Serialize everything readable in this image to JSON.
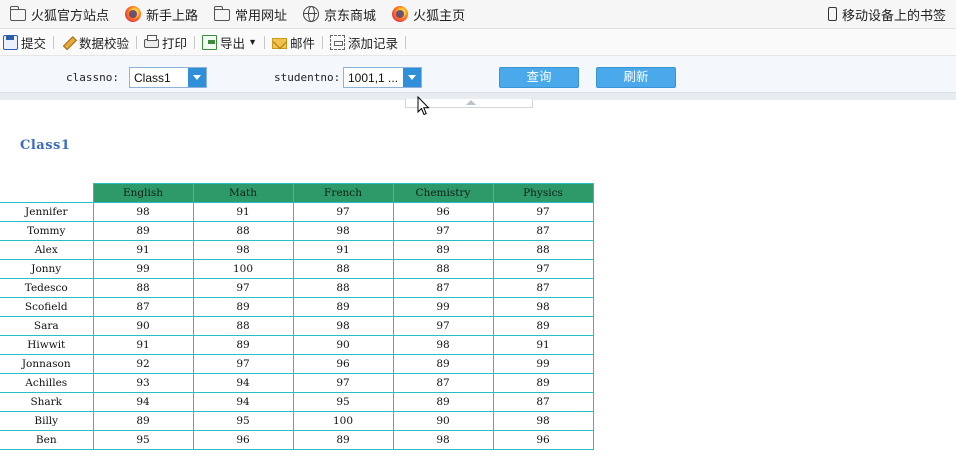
{
  "bookmarks": {
    "items": [
      {
        "label": "火狐官方站点",
        "icon": "folder-icon"
      },
      {
        "label": "新手上路",
        "icon": "firefox-icon"
      },
      {
        "label": "常用网址",
        "icon": "folder-icon"
      },
      {
        "label": "京东商城",
        "icon": "globe-icon"
      },
      {
        "label": "火狐主页",
        "icon": "firefox-icon"
      }
    ],
    "mobile_label": "移动设备上的书签"
  },
  "toolbar": {
    "submit": "提交",
    "validate": "数据校验",
    "print": "打印",
    "export": "导出",
    "mail": "邮件",
    "add_record": "添加记录"
  },
  "params": {
    "classno_label": "classno:",
    "classno_value": "Class1",
    "studentno_label": "studentno:",
    "studentno_value": "1001,1 ...",
    "query_label": "查询",
    "refresh_label": "刷新"
  },
  "report": {
    "title": "Class1",
    "columns": [
      "English",
      "Math",
      "French",
      "Chemistry",
      "Physics"
    ],
    "rows": [
      {
        "name": "Jennifer",
        "scores": [
          98,
          91,
          97,
          96,
          97
        ]
      },
      {
        "name": "Tommy",
        "scores": [
          89,
          88,
          98,
          97,
          87
        ]
      },
      {
        "name": "Alex",
        "scores": [
          91,
          98,
          91,
          89,
          88
        ]
      },
      {
        "name": "Jonny",
        "scores": [
          99,
          100,
          88,
          88,
          97
        ]
      },
      {
        "name": "Tedesco",
        "scores": [
          88,
          97,
          88,
          87,
          87
        ]
      },
      {
        "name": "Scofield",
        "scores": [
          87,
          89,
          89,
          99,
          98
        ]
      },
      {
        "name": "Sara",
        "scores": [
          90,
          88,
          98,
          97,
          89
        ]
      },
      {
        "name": "Hiwwit",
        "scores": [
          91,
          89,
          90,
          98,
          91
        ]
      },
      {
        "name": "Jonnason",
        "scores": [
          92,
          97,
          96,
          89,
          99
        ]
      },
      {
        "name": "Achilles",
        "scores": [
          93,
          94,
          97,
          87,
          89
        ]
      },
      {
        "name": "Shark",
        "scores": [
          94,
          94,
          95,
          89,
          87
        ]
      },
      {
        "name": "Billy",
        "scores": [
          89,
          95,
          100,
          90,
          98
        ]
      },
      {
        "name": "Ben",
        "scores": [
          95,
          96,
          89,
          98,
          96
        ]
      }
    ]
  },
  "colors": {
    "header_bg": "#2e9a6a",
    "grid_border": "#25c0c6",
    "title": "#3b6bc1",
    "button": "#4aa9ea"
  }
}
